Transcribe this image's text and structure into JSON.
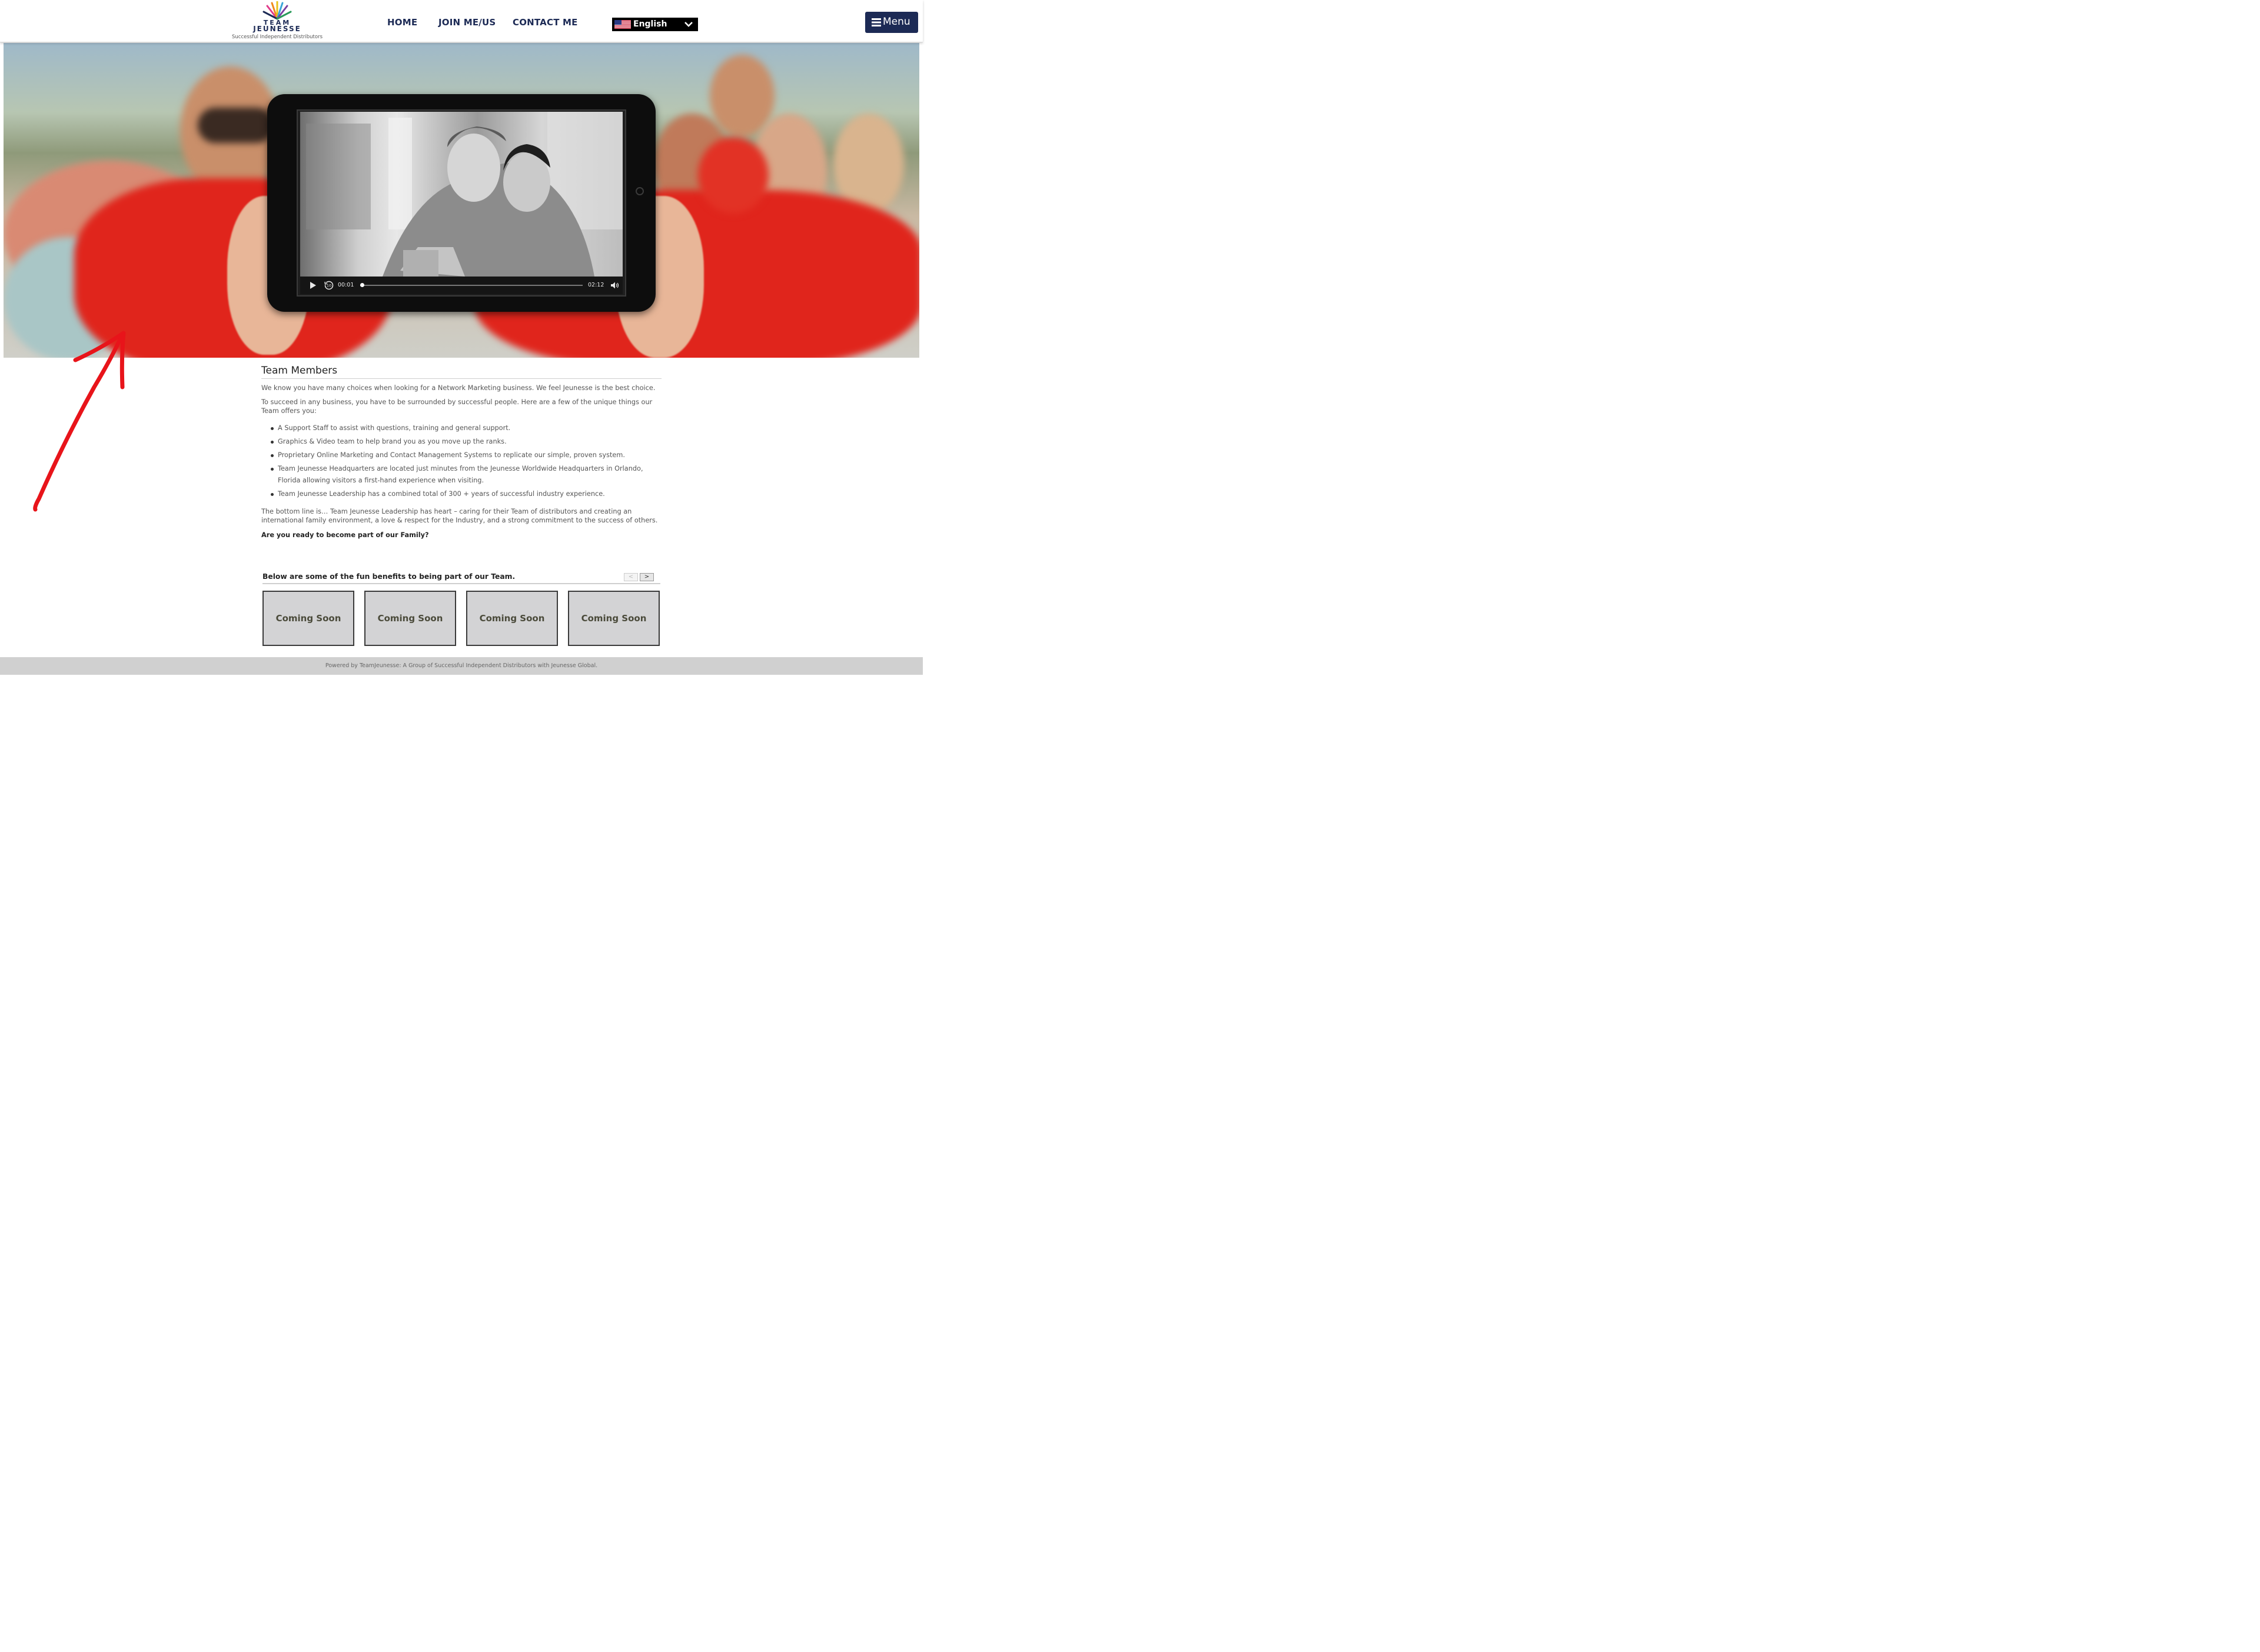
{
  "header": {
    "logo": {
      "line1": "TEAM",
      "line2": "JEUNESSE",
      "tagline": "Successful Independent Distributors"
    },
    "nav": [
      {
        "label": "HOME"
      },
      {
        "label": "JOIN ME/US"
      },
      {
        "label": "CONTACT ME"
      }
    ],
    "language": {
      "selected": "English",
      "flag_icon": "us-flag-icon"
    },
    "menu_button": {
      "label": "Menu",
      "icon": "hamburger-icon"
    }
  },
  "video_player": {
    "current_time": "00:01",
    "duration": "02:12",
    "progress": 0.008,
    "icons": [
      "play-icon",
      "rewind-10-icon",
      "volume-icon"
    ]
  },
  "main": {
    "title": "Team Members",
    "para1": "We know you have many choices when looking for a Network Marketing business. We feel Jeunesse is the best choice.",
    "para2": "To succeed in any business, you have to be surrounded by successful people. Here are a few of the unique things our Team offers you:",
    "benefits": [
      "A Support Staff to assist with questions, training and general support.",
      "Graphics & Video team to help brand you as you move up the ranks.",
      "Proprietary Online Marketing and Contact Management Systems to replicate our simple, proven system.",
      "Team Jeunesse Headquarters are located just minutes from the Jeunesse Worldwide Headquarters in Orlando, Florida allowing visitors a first-hand experience when visiting.",
      "Team Jeunesse Leadership has a combined total of 300 + years of successful industry experience."
    ],
    "para3": "The bottom line is… Team Jeunesse Leadership has heart – caring for their Team of distributors and creating an international family environment, a love & respect for the Industry, and a strong commitment to the success of others.",
    "question": "Are you ready to become part of our Family?"
  },
  "carousel": {
    "title": "Below are some of the fun benefits to being part of our Team.",
    "prev_label": "<",
    "next_label": ">",
    "cards": [
      {
        "label": "Coming Soon"
      },
      {
        "label": "Coming Soon"
      },
      {
        "label": "Coming Soon"
      },
      {
        "label": "Coming Soon"
      }
    ]
  },
  "footer": {
    "text": "Powered by TeamJeunesse: A Group of Successful Independent Distributors with Jeunesse Global."
  },
  "colors": {
    "brand_navy": "#1c2a55",
    "hero_red": "#e0251c",
    "annotation_red": "#e8141a",
    "footer_bg": "#d0d0d0"
  }
}
